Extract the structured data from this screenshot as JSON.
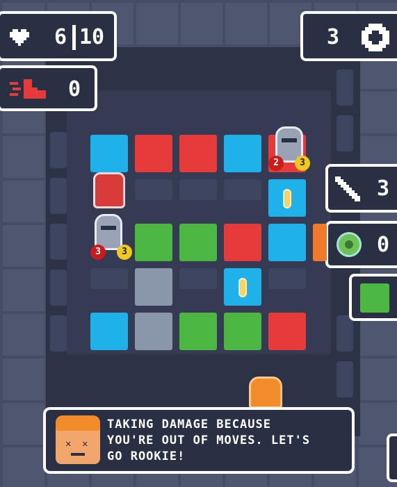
{
  "hud": {
    "health_current": "6",
    "health_max": "10",
    "moves_count": "0",
    "coins_count": "3",
    "sword_count": "3",
    "orb_count": "0"
  },
  "enemies": [
    {
      "hp": "2",
      "attack": "3"
    },
    {
      "hp": "3",
      "attack": "3"
    }
  ],
  "message": {
    "text": "TAKING DAMAGE BECAUSE\nYOU'RE OUT OF MOVES. LET'S\nGO ROOKIE!"
  },
  "colors": {
    "cyan": "#1fb1ea",
    "red": "#e63b3b",
    "green": "#4cb843",
    "gray": "#8a96aa",
    "panel": "#2a3043"
  },
  "icons": [
    "heart-icon",
    "boot-icon",
    "coin-icon",
    "sword-icon",
    "orb-icon",
    "gem-icon"
  ]
}
